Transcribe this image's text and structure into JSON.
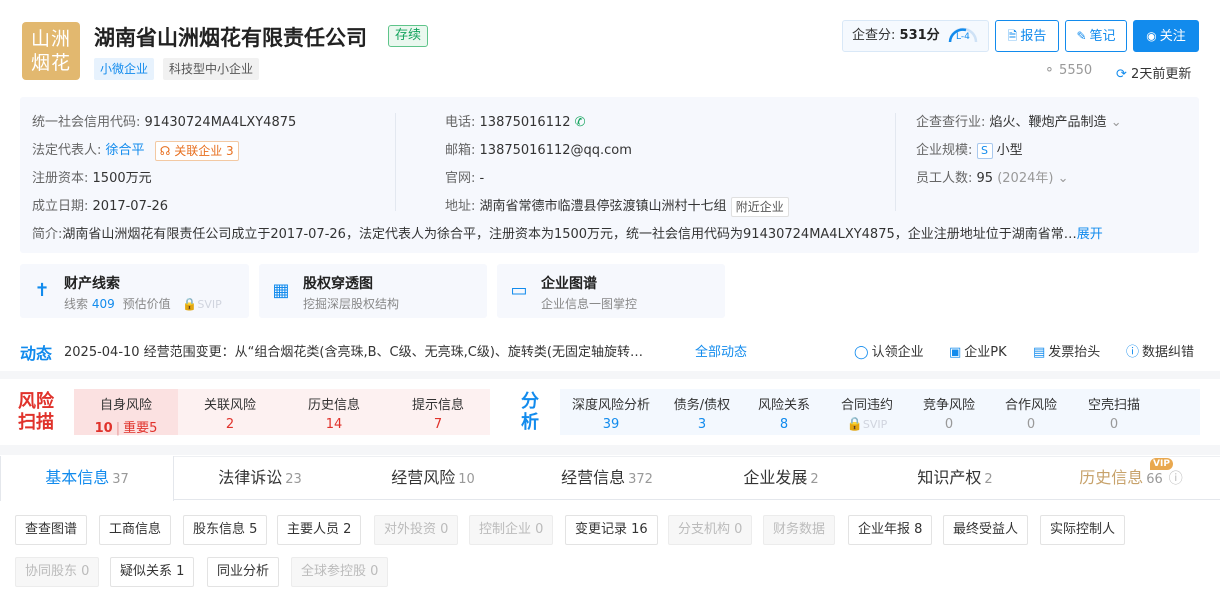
{
  "header": {
    "logo_line1": "山洲",
    "logo_line2": "烟花",
    "company_name": "湖南省山洲烟花有限责任公司",
    "status": "存续",
    "tags": [
      "小微企业",
      "科技型中小企业"
    ],
    "score_label": "企查分:",
    "score_value": "531分",
    "score_level": "L-4",
    "buttons": {
      "report": "报告",
      "note": "笔记",
      "follow": "关注"
    },
    "views": "5550",
    "updated": "2天前更新"
  },
  "info": {
    "credit_code_label": "统一社会信用代码:",
    "credit_code": "91430724MA4LXY4875",
    "legal_rep_label": "法定代表人:",
    "legal_rep": "徐合平",
    "related_label": "关联企业",
    "related_count": "3",
    "capital_label": "注册资本:",
    "capital": "1500万元",
    "founded_label": "成立日期:",
    "founded": "2017-07-26",
    "phone_label": "电话:",
    "phone": "13875016112",
    "email_label": "邮箱:",
    "email": "13875016112@qq.com",
    "website_label": "官网:",
    "website": "-",
    "address_label": "地址:",
    "address": "湖南省常德市临澧县停弦渡镇山洲村十七组",
    "nearby": "附近企业",
    "industry_label": "企查查行业:",
    "industry": "焰火、鞭炮产品制造",
    "scale_label": "企业规模:",
    "scale_badge": "S",
    "scale": "小型",
    "staff_label": "员工人数:",
    "staff": "95",
    "staff_year": "(2024年)",
    "intro_label": "简介:",
    "intro": "湖南省山洲烟花有限责任公司成立于2017-07-26，法定代表人为徐合平，注册资本为1500万元，统一社会信用代码为91430724MA4LXY4875，企业注册地址位于湖南省常…",
    "expand": "展开"
  },
  "cards": [
    {
      "title": "财产线索",
      "sub_label": "线索",
      "sub_count": "409",
      "sub_extra": "预估价值",
      "badge": "SVIP"
    },
    {
      "title": "股权穿透图",
      "sub": "挖掘深层股权结构"
    },
    {
      "title": "企业图谱",
      "sub": "企业信息一图掌控"
    }
  ],
  "dynamic": {
    "title": "动态",
    "text": "2025-04-10 经营范围变更：从“组合烟花类(含亮珠,B、C级、无亮珠,C级)、旋转类(无固定轴旋转…",
    "all_link": "全部动态",
    "actions": [
      "认领企业",
      "企业PK",
      "发票抬头",
      "数据纠错"
    ]
  },
  "risk": {
    "title_line1": "风险",
    "title_line2": "扫描",
    "items": [
      {
        "label": "自身风险",
        "value": "10",
        "extra": "重要5"
      },
      {
        "label": "关联风险",
        "value": "2"
      },
      {
        "label": "历史信息",
        "value": "14"
      },
      {
        "label": "提示信息",
        "value": "7"
      }
    ]
  },
  "analysis": {
    "title_line1": "分",
    "title_line2": "析",
    "items": [
      {
        "label": "深度风险分析",
        "value": "39"
      },
      {
        "label": "债务/债权",
        "value": "3"
      },
      {
        "label": "风险关系",
        "value": "8"
      },
      {
        "label": "合同违约",
        "value": "SVIP"
      },
      {
        "label": "竞争风险",
        "value": "0"
      },
      {
        "label": "合作风险",
        "value": "0"
      },
      {
        "label": "空壳扫描",
        "value": "0"
      }
    ]
  },
  "tabs": [
    {
      "label": "基本信息",
      "count": "37"
    },
    {
      "label": "法律诉讼",
      "count": "23"
    },
    {
      "label": "经营风险",
      "count": "10"
    },
    {
      "label": "经营信息",
      "count": "372"
    },
    {
      "label": "企业发展",
      "count": "2"
    },
    {
      "label": "知识产权",
      "count": "2"
    },
    {
      "label": "历史信息",
      "count": "66",
      "badge": "VIP"
    }
  ],
  "subtabs_row1": [
    {
      "label": "查查图谱"
    },
    {
      "label": "工商信息"
    },
    {
      "label": "股东信息 5"
    },
    {
      "label": "主要人员 2"
    },
    {
      "label": "对外投资 0"
    },
    {
      "label": "控制企业 0"
    },
    {
      "label": "变更记录 16"
    },
    {
      "label": "分支机构 0"
    },
    {
      "label": "财务数据"
    },
    {
      "label": "企业年报 8"
    },
    {
      "label": "最终受益人"
    },
    {
      "label": "实际控制人"
    }
  ],
  "subtabs_row2": [
    {
      "label": "协同股东 0"
    },
    {
      "label": "疑似关系 1"
    },
    {
      "label": "同业分析"
    },
    {
      "label": "全球参控股 0"
    }
  ],
  "colors": {
    "accent": "#128bed",
    "risk": "#e0322b",
    "status": "#14a35d",
    "logo": "#e2b86f"
  }
}
